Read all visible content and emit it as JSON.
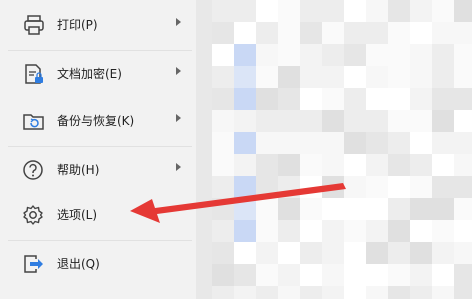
{
  "menu": {
    "items": [
      {
        "label": "打印(P)",
        "icon": "printer-icon",
        "has_submenu": true
      },
      {
        "label": "文档加密(E)",
        "icon": "document-lock-icon",
        "has_submenu": true
      },
      {
        "label": "备份与恢复(K)",
        "icon": "backup-restore-icon",
        "has_submenu": true
      },
      {
        "label": "帮助(H)",
        "icon": "help-icon",
        "has_submenu": true
      },
      {
        "label": "选项(L)",
        "icon": "gear-icon",
        "has_submenu": false
      },
      {
        "label": "退出(Q)",
        "icon": "exit-icon",
        "has_submenu": false
      }
    ]
  },
  "annotation": {
    "color": "#e53935",
    "points_to": "选项(L)"
  },
  "colors": {
    "menu_bg": "#f2f2f2",
    "doc_bg": "#ffffff",
    "accent_blue": "#c9d8f5",
    "mosaic": "#e6e6e6"
  }
}
